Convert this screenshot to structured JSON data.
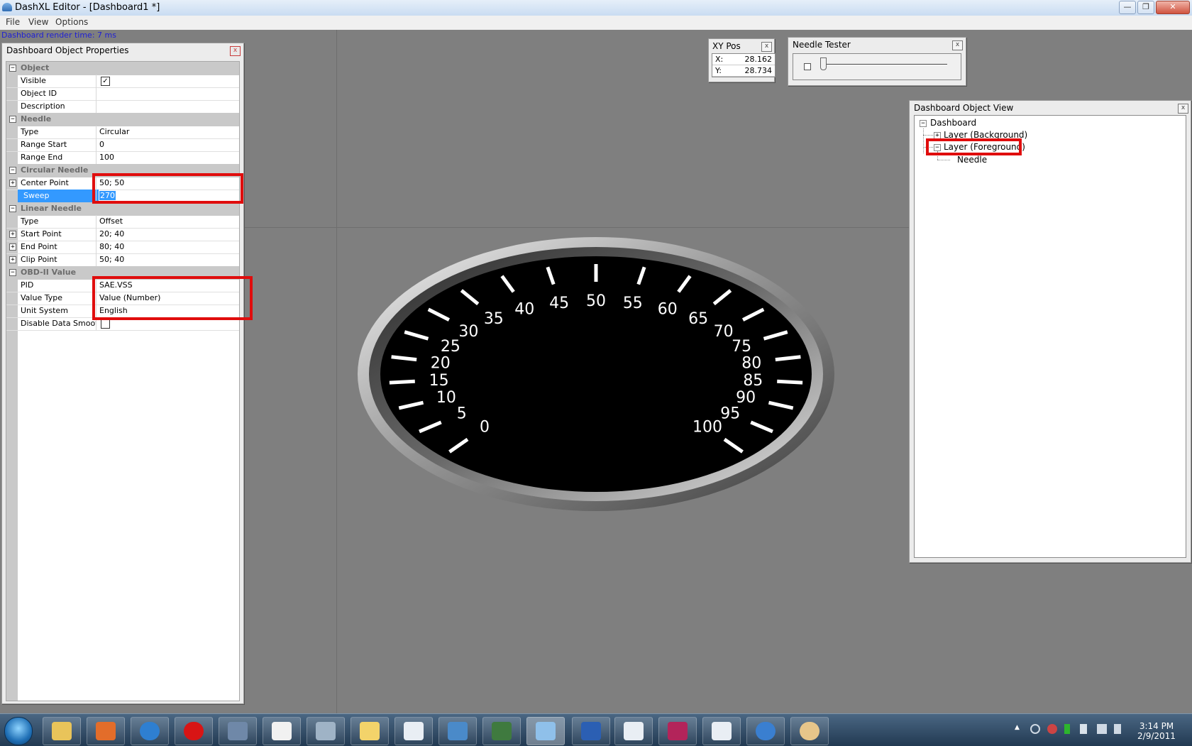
{
  "window": {
    "title": "DashXL Editor - [Dashboard1 *]",
    "minimize": "—",
    "maximize": "❐",
    "close": "✕"
  },
  "menu": [
    "File",
    "View",
    "Options"
  ],
  "status": {
    "render_time": "Dashboard render time: 7 ms"
  },
  "properties_panel": {
    "title": "Dashboard Object Properties",
    "close": "x",
    "categories": {
      "object": "Object",
      "needle": "Needle",
      "circular": "Circular Needle",
      "linear": "Linear Needle",
      "obd": "OBD-II Value"
    },
    "rows": {
      "visible": {
        "name": "Visible",
        "value": "✓"
      },
      "object_id": {
        "name": "Object ID",
        "value": ""
      },
      "description": {
        "name": "Description",
        "value": ""
      },
      "needle_type": {
        "name": "Type",
        "value": "Circular"
      },
      "range_start": {
        "name": "Range Start",
        "value": "0"
      },
      "range_end": {
        "name": "Range End",
        "value": "100"
      },
      "center_point": {
        "name": "Center Point",
        "value": "50; 50"
      },
      "sweep": {
        "name": "Sweep",
        "value": "270"
      },
      "linear_type": {
        "name": "Type",
        "value": "Offset"
      },
      "start_point": {
        "name": "Start Point",
        "value": "20; 40"
      },
      "end_point": {
        "name": "End Point",
        "value": "80; 40"
      },
      "clip_point": {
        "name": "Clip Point",
        "value": "50; 40"
      },
      "pid": {
        "name": "PID",
        "value": "SAE.VSS"
      },
      "value_type": {
        "name": "Value Type",
        "value": "Value (Number)"
      },
      "unit_system": {
        "name": "Unit System",
        "value": "English"
      },
      "disable_smoothing": {
        "name": "Disable Data Smoothin",
        "value": ""
      }
    }
  },
  "xy_pos": {
    "title": "XY Pos",
    "close": "x",
    "x_label": "X:",
    "x_value": "28.162",
    "y_label": "Y:",
    "y_value": "28.734"
  },
  "needle_tester": {
    "title": "Needle Tester",
    "close": "x"
  },
  "object_view": {
    "title": "Dashboard Object View",
    "close": "x",
    "root": "Dashboard",
    "layer_bg": "Layer (Background)",
    "layer_fg": "Layer (Foreground)",
    "needle": "Needle"
  },
  "gauge": {
    "labels": [
      "0",
      "5",
      "10",
      "15",
      "20",
      "25",
      "30",
      "35",
      "40",
      "45",
      "50",
      "55",
      "60",
      "65",
      "70",
      "75",
      "80",
      "85",
      "90",
      "95",
      "100"
    ],
    "range_min": 0,
    "range_max": 100,
    "sweep_degrees": 270
  },
  "taskbar": {
    "time": "3:14 PM",
    "date": "2/9/2011",
    "tray_arrow": "▲"
  },
  "colors": {
    "canvas": "#7f7f7f",
    "highlight": "#3399ff",
    "annotation": "#e00d0d"
  }
}
